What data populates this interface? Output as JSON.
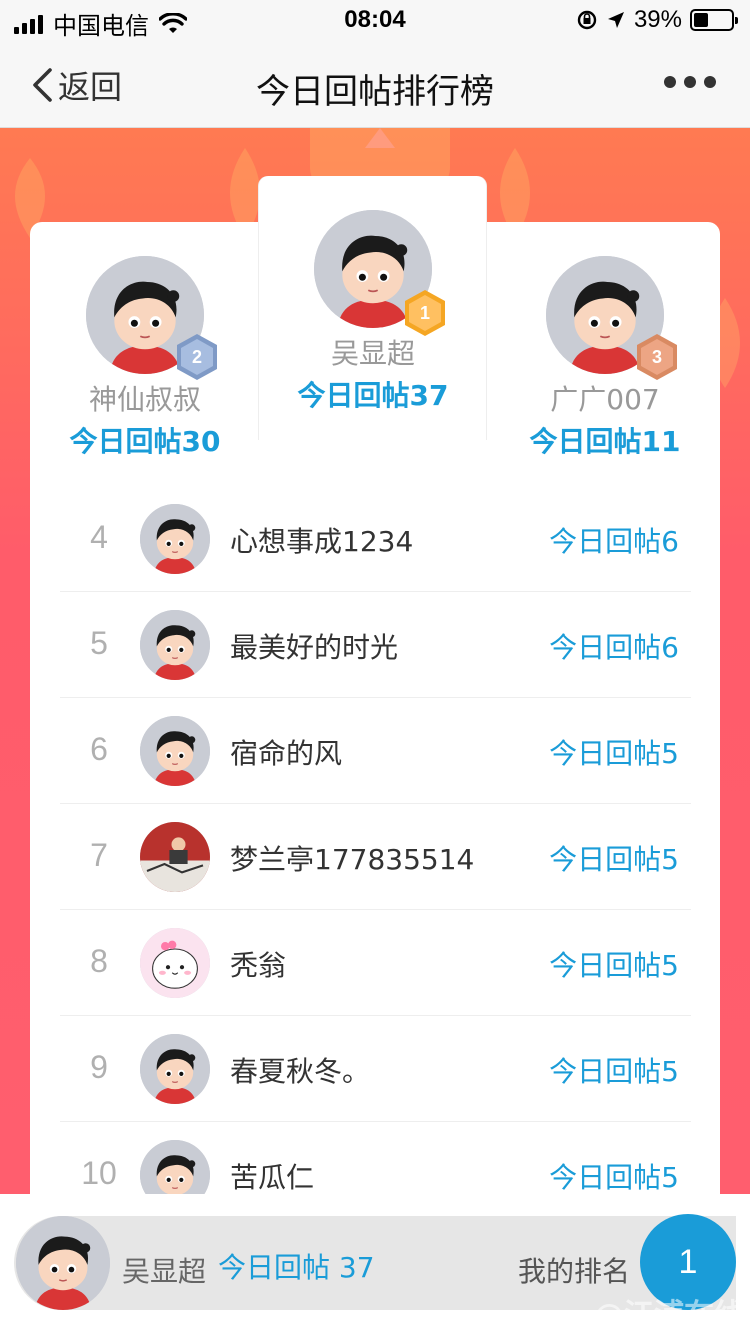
{
  "status_bar": {
    "carrier": "中国电信",
    "time": "08:04",
    "battery_text": "39%",
    "battery_level": 0.39
  },
  "nav": {
    "back_label": "返回",
    "title": "今日回帖排行榜"
  },
  "podium": {
    "first": {
      "name": "吴显超",
      "count_label": "今日回帖37",
      "rank": "1"
    },
    "second": {
      "name": "神仙叔叔",
      "count_label": "今日回帖30",
      "rank": "2"
    },
    "third": {
      "name": "广广007",
      "count_label": "今日回帖11",
      "rank": "3"
    }
  },
  "list": [
    {
      "rank": "4",
      "name": "心想事成1234",
      "count_label": "今日回帖6",
      "avatar": "cartoon"
    },
    {
      "rank": "5",
      "name": "最美好的时光",
      "count_label": "今日回帖6",
      "avatar": "cartoon"
    },
    {
      "rank": "6",
      "name": "宿命的风",
      "count_label": "今日回帖5",
      "avatar": "cartoon"
    },
    {
      "rank": "7",
      "name": "梦兰亭177835514",
      "count_label": "今日回帖5",
      "avatar": "photo"
    },
    {
      "rank": "8",
      "name": "秃翁",
      "count_label": "今日回帖5",
      "avatar": "cute"
    },
    {
      "rank": "9",
      "name": "春夏秋冬。",
      "count_label": "今日回帖5",
      "avatar": "cartoon"
    },
    {
      "rank": "10",
      "name": "苦瓜仁",
      "count_label": "今日回帖5",
      "avatar": "cartoon"
    }
  ],
  "footer": {
    "my_name": "吴显超",
    "my_count_label": "今日回帖 37",
    "my_rank_label": "我的排名",
    "my_rank": "1",
    "watermark": "@江浦在线"
  },
  "colors": {
    "accent": "#1a9cd8",
    "hero_top": "#ff7a52",
    "hero_bottom": "#ff5e6e",
    "gold": "#f5a623",
    "silver": "#7f9ac6",
    "bronze": "#d98a62"
  }
}
